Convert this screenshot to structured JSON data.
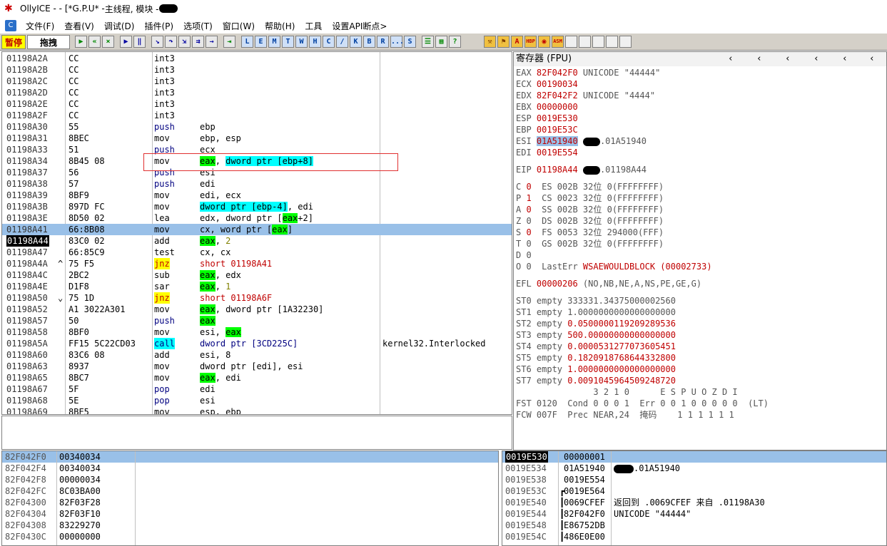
{
  "title": {
    "app": "OllyICE - - [*G.P.U* - ",
    "thread": "主线程, 模块 - ",
    "close": "]"
  },
  "menu": {
    "items": [
      "文件(F)",
      "查看(V)",
      "调试(D)",
      "插件(P)",
      "选项(T)",
      "窗口(W)",
      "帮助(H)",
      "工具",
      "设置API断点>"
    ]
  },
  "toolbar": {
    "status": "暂停",
    "drag": "拖拽",
    "letters": [
      "L",
      "E",
      "M",
      "T",
      "W",
      "H",
      "C",
      "/",
      "K",
      "B",
      "R",
      "...",
      "S"
    ],
    "plugins": [
      "HBP",
      "ASM"
    ]
  },
  "disasm": {
    "rows": [
      {
        "addr": "01198A2A",
        "hex": "CC",
        "mn": "int3",
        "op": ""
      },
      {
        "addr": "01198A2B",
        "hex": "CC",
        "mn": "int3",
        "op": ""
      },
      {
        "addr": "01198A2C",
        "hex": "CC",
        "mn": "int3",
        "op": ""
      },
      {
        "addr": "01198A2D",
        "hex": "CC",
        "mn": "int3",
        "op": ""
      },
      {
        "addr": "01198A2E",
        "hex": "CC",
        "mn": "int3",
        "op": ""
      },
      {
        "addr": "01198A2F",
        "hex": "CC",
        "mn": "int3",
        "op": ""
      },
      {
        "addr": "01198A30",
        "hex": "55",
        "mn": "push",
        "op": "ebp"
      },
      {
        "addr": "01198A31",
        "hex": "8BEC",
        "mn": "mov",
        "op": "ebp, esp"
      },
      {
        "addr": "01198A33",
        "hex": "51",
        "mn": "push",
        "op": "ecx"
      },
      {
        "addr": "01198A34",
        "hex": "8B45 08",
        "mn": "mov",
        "op": "eax, dword ptr [ebp+8]"
      },
      {
        "addr": "01198A37",
        "hex": "56",
        "mn": "push",
        "op": "esi"
      },
      {
        "addr": "01198A38",
        "hex": "57",
        "mn": "push",
        "op": "edi"
      },
      {
        "addr": "01198A39",
        "hex": "8BF9",
        "mn": "mov",
        "op": "edi, ecx"
      },
      {
        "addr": "01198A3B",
        "hex": "897D FC",
        "mn": "mov",
        "op": "dword ptr [ebp-4], edi"
      },
      {
        "addr": "01198A3E",
        "hex": "8D50 02",
        "mn": "lea",
        "op": "edx, dword ptr [eax+2]"
      },
      {
        "addr": "01198A41",
        "hex": "66:8B08",
        "mn": "mov",
        "op": "cx, word ptr [eax]"
      },
      {
        "addr": "01198A44",
        "hex": "83C0 02",
        "mn": "add",
        "op": "eax, 2"
      },
      {
        "addr": "01198A47",
        "hex": "66:85C9",
        "mn": "test",
        "op": "cx, cx"
      },
      {
        "addr": "01198A4A",
        "hex": "75 F5",
        "mn": "jnz",
        "op": "short 01198A41"
      },
      {
        "addr": "01198A4C",
        "hex": "2BC2",
        "mn": "sub",
        "op": "eax, edx"
      },
      {
        "addr": "01198A4E",
        "hex": "D1F8",
        "mn": "sar",
        "op": "eax, 1"
      },
      {
        "addr": "01198A50",
        "hex": "75 1D",
        "mn": "jnz",
        "op": "short 01198A6F"
      },
      {
        "addr": "01198A52",
        "hex": "A1 3022A301",
        "mn": "mov",
        "op": "eax, dword ptr [1A32230]"
      },
      {
        "addr": "01198A57",
        "hex": "50",
        "mn": "push",
        "op": "eax"
      },
      {
        "addr": "01198A58",
        "hex": "8BF0",
        "mn": "mov",
        "op": "esi, eax"
      },
      {
        "addr": "01198A5A",
        "hex": "FF15 5C22CD03",
        "mn": "call",
        "op": "dword ptr [3CD225C]",
        "cm": "kernel32.Interlocked"
      },
      {
        "addr": "01198A60",
        "hex": "83C6 08",
        "mn": "add",
        "op": "esi, 8"
      },
      {
        "addr": "01198A63",
        "hex": "8937",
        "mn": "mov",
        "op": "dword ptr [edi], esi"
      },
      {
        "addr": "01198A65",
        "hex": "8BC7",
        "mn": "mov",
        "op": "eax, edi"
      },
      {
        "addr": "01198A67",
        "hex": "5F",
        "mn": "pop",
        "op": "edi"
      },
      {
        "addr": "01198A68",
        "hex": "5E",
        "mn": "pop",
        "op": "esi"
      },
      {
        "addr": "01198A69",
        "hex": "8BE5",
        "mn": "mov",
        "op": "esp, ebp"
      }
    ]
  },
  "registers": {
    "title": "寄存器 (FPU)",
    "lines": [
      "EAX 82F042F0 UNICODE \"44444\"",
      "ECX 00190034",
      "EDX 82F042F2 UNICODE \"4444\"",
      "EBX 00000000",
      "ESP 0019E530",
      "EBP 0019E53C",
      "ESI 01A51940 .01A51940",
      "EDI 0019E554",
      "",
      "EIP 01198A44 .01198A44",
      "",
      "C 0  ES 002B 32位 0(FFFFFFFF)",
      "P 1  CS 0023 32位 0(FFFFFFFF)",
      "A 0  SS 002B 32位 0(FFFFFFFF)",
      "Z 0  DS 002B 32位 0(FFFFFFFF)",
      "S 0  FS 0053 32位 294000(FFF)",
      "T 0  GS 002B 32位 0(FFFFFFFF)",
      "D 0",
      "O 0  LastErr WSAEWOULDBLOCK (00002733)",
      "",
      "EFL 00000206 (NO,NB,NE,A,NS,PE,GE,G)",
      "",
      "ST0 empty 333331.34375000002560",
      "ST1 empty 1.0000000000000000000",
      "ST2 empty 0.0500000119209289536",
      "ST3 empty 500.00000000000000000",
      "ST4 empty 0.0000531277073605451",
      "ST5 empty 0.1820918768644332800",
      "ST6 empty 1.0000000000000000000",
      "ST7 empty 0.0091045964509248720",
      "               3 2 1 0      E S P U O Z D I",
      "FST 0120  Cond 0 0 0 1  Err 0 0 1 0 0 0 0 0  (LT)",
      "FCW 007F  Prec NEAR,24  掩码    1 1 1 1 1 1"
    ]
  },
  "dump": {
    "rows": [
      {
        "addr": "82F042F0",
        "val": "00340034"
      },
      {
        "addr": "82F042F4",
        "val": "00340034"
      },
      {
        "addr": "82F042F8",
        "val": "00000034"
      },
      {
        "addr": "82F042FC",
        "val": "8C03BA00"
      },
      {
        "addr": "82F04300",
        "val": "82F03F28"
      },
      {
        "addr": "82F04304",
        "val": "82F03F10"
      },
      {
        "addr": "82F04308",
        "val": "83229270"
      },
      {
        "addr": "82F0430C",
        "val": "00000000"
      }
    ]
  },
  "stack": {
    "rows": [
      {
        "addr": "0019E530",
        "val": "00000001",
        "cm": ""
      },
      {
        "addr": "0019E534",
        "val": "01A51940",
        "cm": ".01A51940"
      },
      {
        "addr": "0019E538",
        "val": "0019E554",
        "cm": ""
      },
      {
        "addr": "0019E53C",
        "val": "0019E564",
        "cm": ""
      },
      {
        "addr": "0019E540",
        "val": "0069CFEF",
        "cm": "返回到 .0069CFEF 来自 .01198A30"
      },
      {
        "addr": "0019E544",
        "val": "82F042F0",
        "cm": "UNICODE \"44444\""
      },
      {
        "addr": "0019E548",
        "val": "E86752DB",
        "cm": ""
      },
      {
        "addr": "0019E54C",
        "val": "486E0E00",
        "cm": ""
      }
    ]
  }
}
